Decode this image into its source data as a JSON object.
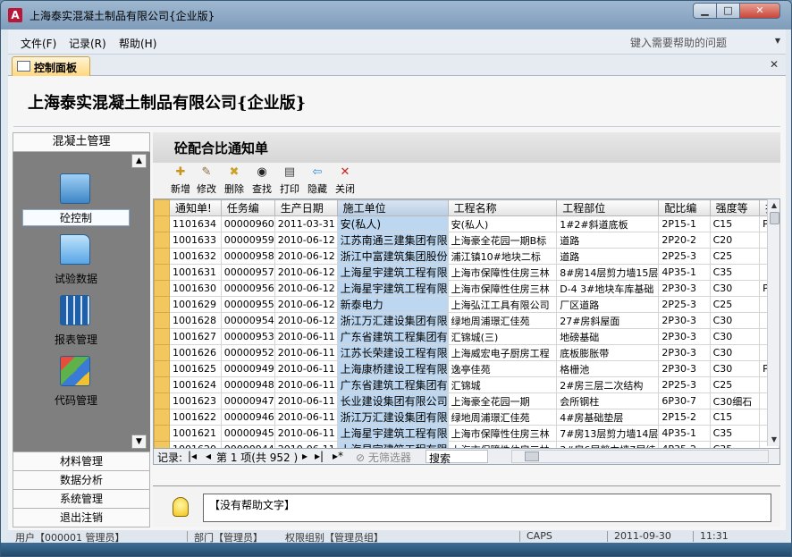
{
  "window": {
    "title": "上海泰实混凝土制品有限公司{企业版}",
    "icon_letter": "A"
  },
  "menu": {
    "items": [
      "文件(F)",
      "记录(R)",
      "帮助(H)"
    ],
    "help_placeholder": "键入需要帮助的问题"
  },
  "tab": {
    "label": "控制面板"
  },
  "company_title": "上海泰实混凝土制品有限公司{企业版}",
  "nav": {
    "header": "混凝土管理",
    "items": [
      {
        "label": "砼控制",
        "icon": "control-icon",
        "active": true
      },
      {
        "label": "试验数据",
        "icon": "folder-icon",
        "active": false
      },
      {
        "label": "报表管理",
        "icon": "report-icon",
        "active": false
      },
      {
        "label": "代码管理",
        "icon": "code-icon",
        "active": false
      }
    ],
    "sections": [
      "材料管理",
      "数据分析",
      "系统管理",
      "退出注销"
    ]
  },
  "form": {
    "title": "砼配合比通知单",
    "toolbar": [
      {
        "label": "新增",
        "icon": "new-icon",
        "glyph": "✚",
        "color": "#c8951b"
      },
      {
        "label": "修改",
        "icon": "edit-icon",
        "glyph": "✎",
        "color": "#8a6d3b"
      },
      {
        "label": "删除",
        "icon": "delete-icon",
        "glyph": "✖",
        "color": "#c9a227"
      },
      {
        "label": "查找",
        "icon": "find-icon",
        "glyph": "◉",
        "color": "#222222"
      },
      {
        "label": "打印",
        "icon": "print-icon",
        "glyph": "▤",
        "color": "#444444"
      },
      {
        "label": "隐藏",
        "icon": "hide-icon",
        "glyph": "⇦",
        "color": "#2e8bd6"
      },
      {
        "label": "关闭",
        "icon": "close-icon",
        "glyph": "✕",
        "color": "#d0211c"
      }
    ]
  },
  "table": {
    "columns": [
      "通知单!",
      "任务编",
      "生产日期",
      "施工单位",
      "工程名称",
      "工程部位",
      "配比编",
      "强度等",
      "抗"
    ],
    "rows": [
      [
        "1101634",
        "00000960",
        "2011-03-31",
        "安(私人)",
        "安(私人)",
        "1#2#斜道底板",
        "2P15-1",
        "C15",
        "P1"
      ],
      [
        "1001633",
        "00000959",
        "2010-06-12",
        "江苏南通三建集团有限",
        "上海豪全花园一期B标",
        "道路",
        "2P20-2",
        "C20",
        ""
      ],
      [
        "1001632",
        "00000958",
        "2010-06-12",
        "浙江中富建筑集团股份",
        "浦江镇10#地块二标",
        "道路",
        "2P25-3",
        "C25",
        ""
      ],
      [
        "1001631",
        "00000957",
        "2010-06-12",
        "上海星宇建筑工程有限",
        "上海市保障性住房三林",
        "8#房14层剪力墙15层",
        "4P35-1",
        "C35",
        ""
      ],
      [
        "1001630",
        "00000956",
        "2010-06-12",
        "上海星宇建筑工程有限",
        "上海市保障性住房三林",
        "D-4 3#地块车库基础",
        "2P30-3",
        "C30",
        "P6"
      ],
      [
        "1001629",
        "00000955",
        "2010-06-12",
        "新泰电力",
        "上海弘江工具有限公司",
        "厂区道路",
        "2P25-3",
        "C25",
        ""
      ],
      [
        "1001628",
        "00000954",
        "2010-06-12",
        "浙江万汇建设集团有限",
        "绿地周浦璟汇佳苑",
        "27#房斜屋面",
        "2P30-3",
        "C30",
        ""
      ],
      [
        "1001627",
        "00000953",
        "2010-06-11",
        "广东省建筑工程集团有",
        "汇锦城(三)",
        "地磅基础",
        "2P30-3",
        "C30",
        ""
      ],
      [
        "1001626",
        "00000952",
        "2010-06-11",
        "江苏长荣建设工程有限",
        "上海威宏电子厨房工程",
        "底板膨胀带",
        "2P30-3",
        "C30",
        ""
      ],
      [
        "1001625",
        "00000949",
        "2010-06-11",
        "上海康桥建设工程有限",
        "逸亭佳苑",
        "格栅池",
        "2P30-3",
        "C30",
        "P6"
      ],
      [
        "1001624",
        "00000948",
        "2010-06-11",
        "广东省建筑工程集团有",
        "汇锦城",
        "2#房三层二次结构",
        "2P25-3",
        "C25",
        ""
      ],
      [
        "1001623",
        "00000947",
        "2010-06-11",
        "长业建设集团有限公司",
        "上海豪全花园一期",
        "会所钢柱",
        "6P30-7",
        "C30细石",
        ""
      ],
      [
        "1001622",
        "00000946",
        "2010-06-11",
        "浙江万汇建设集团有限",
        "绿地周浦璟汇佳苑",
        "4#房基础垫层",
        "2P15-2",
        "C15",
        ""
      ],
      [
        "1001621",
        "00000945",
        "2010-06-11",
        "上海星宇建筑工程有限",
        "上海市保障性住房三林",
        "7#房13层剪力墙14层",
        "4P35-1",
        "C35",
        ""
      ],
      [
        "1001620",
        "00000944",
        "2010-06-11",
        "上海星宇建筑工程有限",
        "上海市保障性住房三林",
        "3#房6层剪力墙7层结",
        "4P35-2",
        "C35",
        ""
      ],
      [
        "1001619",
        "00000943",
        "2010-06-11",
        "上海康桥建设工程有限",
        "逸亭佳苑",
        "配电房垃圾房垫层",
        "2P15-2",
        "C15",
        ""
      ]
    ]
  },
  "record_nav": {
    "label": "记录:",
    "first": "|◂",
    "prev": "◂",
    "position": "第 1 项(共 952 )",
    "next": "▸",
    "last": "▸|",
    "new": "▸*",
    "filter": "无筛选器",
    "search": "搜索"
  },
  "help": {
    "text": "【没有帮助文字】"
  },
  "status": {
    "user": "用户【000001 管理员】",
    "dept": "部门【管理员】",
    "perm": "权限组别【管理员组】",
    "caps": "CAPS",
    "date": "2011-09-30",
    "time": "11:31"
  }
}
